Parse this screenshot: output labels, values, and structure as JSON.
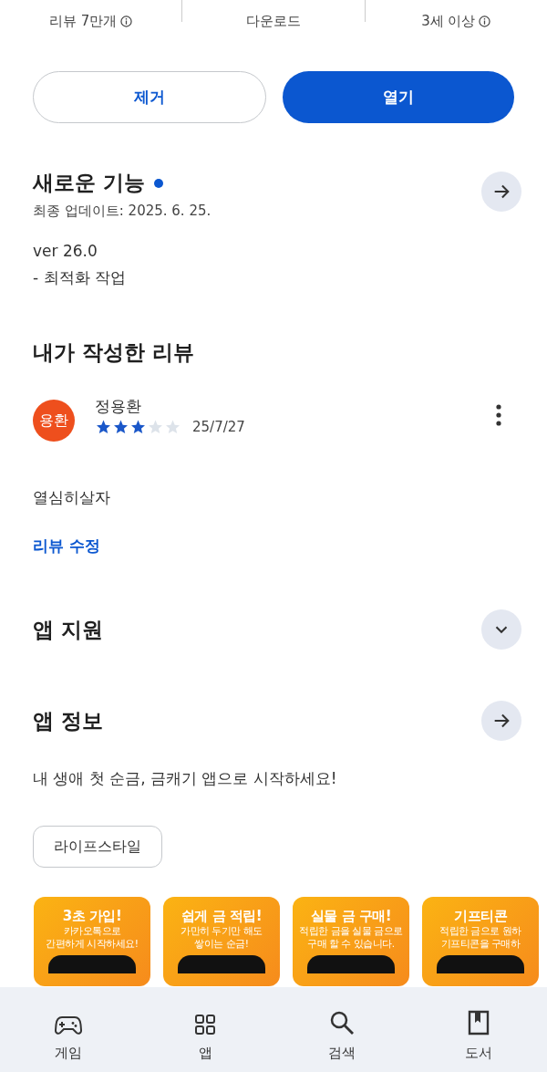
{
  "stats": [
    {
      "label": "리뷰 7만개",
      "info": true
    },
    {
      "label": "다운로드",
      "info": false
    },
    {
      "label": "3세 이상",
      "info": true
    }
  ],
  "actions": [
    {
      "label": "제거",
      "kind": "outline"
    },
    {
      "label": "열기",
      "kind": "filled"
    }
  ],
  "whats_new": {
    "title": "새로운 기능",
    "new": true,
    "updated": "최종 업데이트: 2025. 6. 25.",
    "notes": [
      "ver 26.0",
      "- 최적화 작업"
    ]
  },
  "my_review": {
    "heading": "내가 작성한 리뷰",
    "avatar": "용환",
    "author": "정용환",
    "stars": 3,
    "date": "25/7/27",
    "body": "열심히살자",
    "edit_link": "리뷰 수정"
  },
  "app_support": {
    "title": "앱 지원",
    "expanded": false
  },
  "app_info": {
    "title": "앱 정보",
    "description": "내 생애 첫 순금, 금캐기 앱으로 시작하세요!",
    "tag": "라이프스타일"
  },
  "screenshots": [
    {
      "title": "3초 가입!",
      "lines": [
        "카카오톡으로",
        "간편하게 시작하세요!"
      ]
    },
    {
      "title": "쉽게 금 적립!",
      "lines": [
        "가만히 두기만 해도",
        "쌓이는 순금!"
      ]
    },
    {
      "title": "실물 금 구매!",
      "lines": [
        "적립한 금을 실물 금으로",
        "구매 할 수 있습니다."
      ]
    },
    {
      "title": "기프티콘",
      "lines": [
        "적립한 금으로 원하",
        "기프티콘을 구매하"
      ]
    }
  ],
  "nav": [
    {
      "label": "게임",
      "kind": "game"
    },
    {
      "label": "앱",
      "kind": "apps"
    },
    {
      "label": "검색",
      "kind": "search"
    },
    {
      "label": "도서",
      "kind": "books"
    }
  ]
}
